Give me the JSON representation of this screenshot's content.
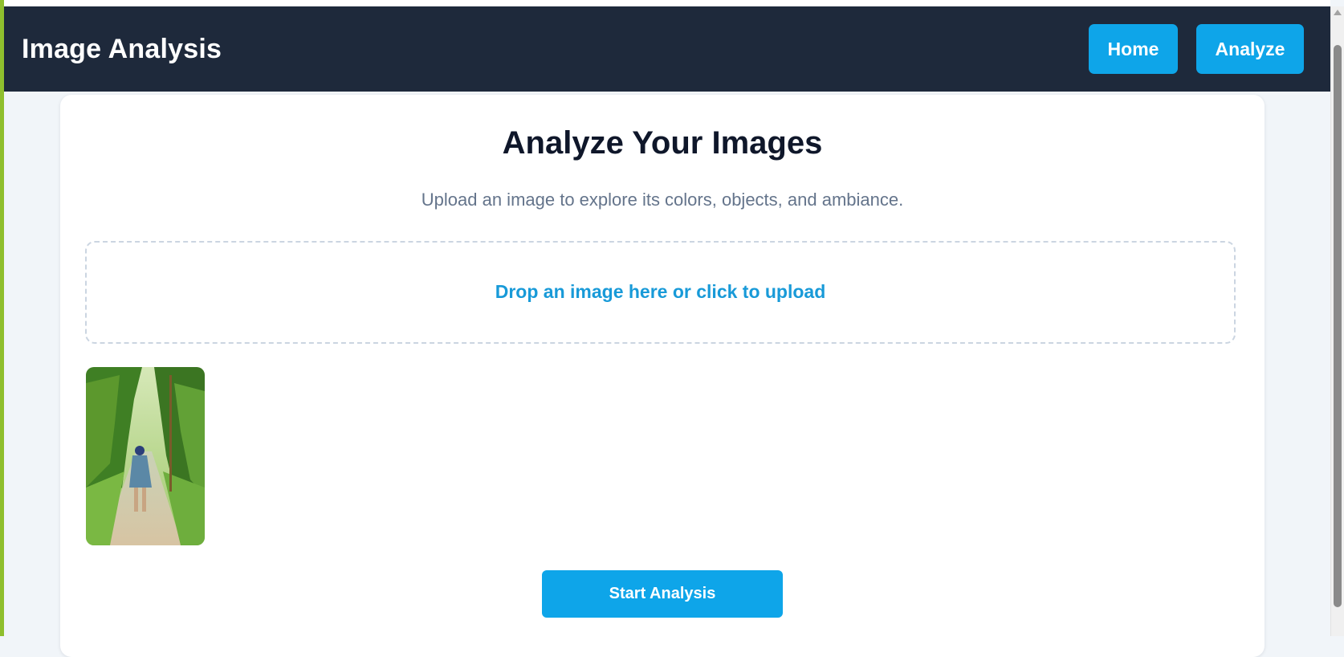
{
  "header": {
    "brand": "Image Analysis",
    "nav": [
      {
        "label": "Home"
      },
      {
        "label": "Analyze"
      }
    ]
  },
  "main": {
    "title": "Analyze Your Images",
    "subtitle": "Upload an image to explore its colors, objects, and ambiance.",
    "dropzone_text": "Drop an image here or click to upload",
    "thumbnail_icon": "uploaded-image-preview",
    "start_button": "Start Analysis"
  },
  "colors": {
    "header_bg": "#1e293b",
    "accent": "#0ea5e9",
    "page_bg": "#f1f5f9",
    "title": "#0f172a",
    "subtitle": "#64748b"
  }
}
